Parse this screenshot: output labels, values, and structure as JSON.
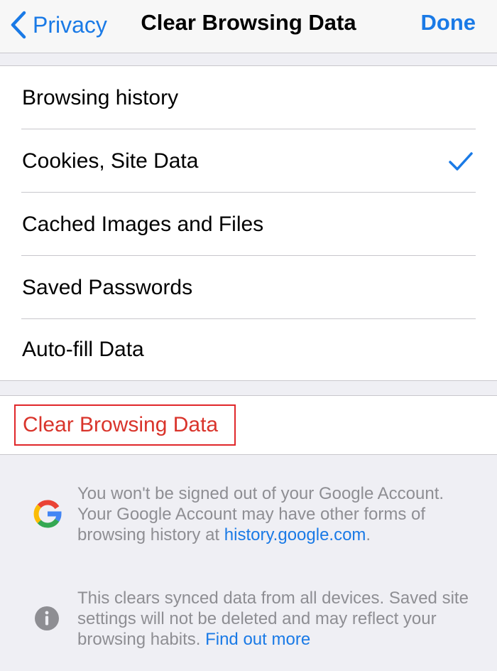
{
  "navbar": {
    "back_label": "Privacy",
    "title": "Clear Browsing Data",
    "done_label": "Done"
  },
  "options": [
    {
      "label": "Browsing history",
      "checked": false
    },
    {
      "label": "Cookies, Site Data",
      "checked": true
    },
    {
      "label": "Cached Images and Files",
      "checked": false
    },
    {
      "label": "Saved Passwords",
      "checked": false
    },
    {
      "label": "Auto-fill Data",
      "checked": false
    }
  ],
  "clear_button": {
    "label": "Clear Browsing Data"
  },
  "google_notice": {
    "text": "You won't be signed out of your Google Account. Your Google Account may have other forms of browsing history at ",
    "link": "history.google.com",
    "suffix": "."
  },
  "sync_notice": {
    "text": "This clears synced data from all devices. Saved site settings will not be deleted and may reflect your browsing habits. ",
    "link": "Find out more"
  },
  "colors": {
    "accent": "#1a7ae6",
    "destructive": "#d9342b",
    "highlight_border": "#e0272a",
    "secondary_text": "#8e8e93",
    "background": "#efeff4"
  },
  "icons": {
    "back": "chevron-left-icon",
    "check": "checkmark-icon",
    "google": "google-logo-icon",
    "info": "info-icon"
  }
}
